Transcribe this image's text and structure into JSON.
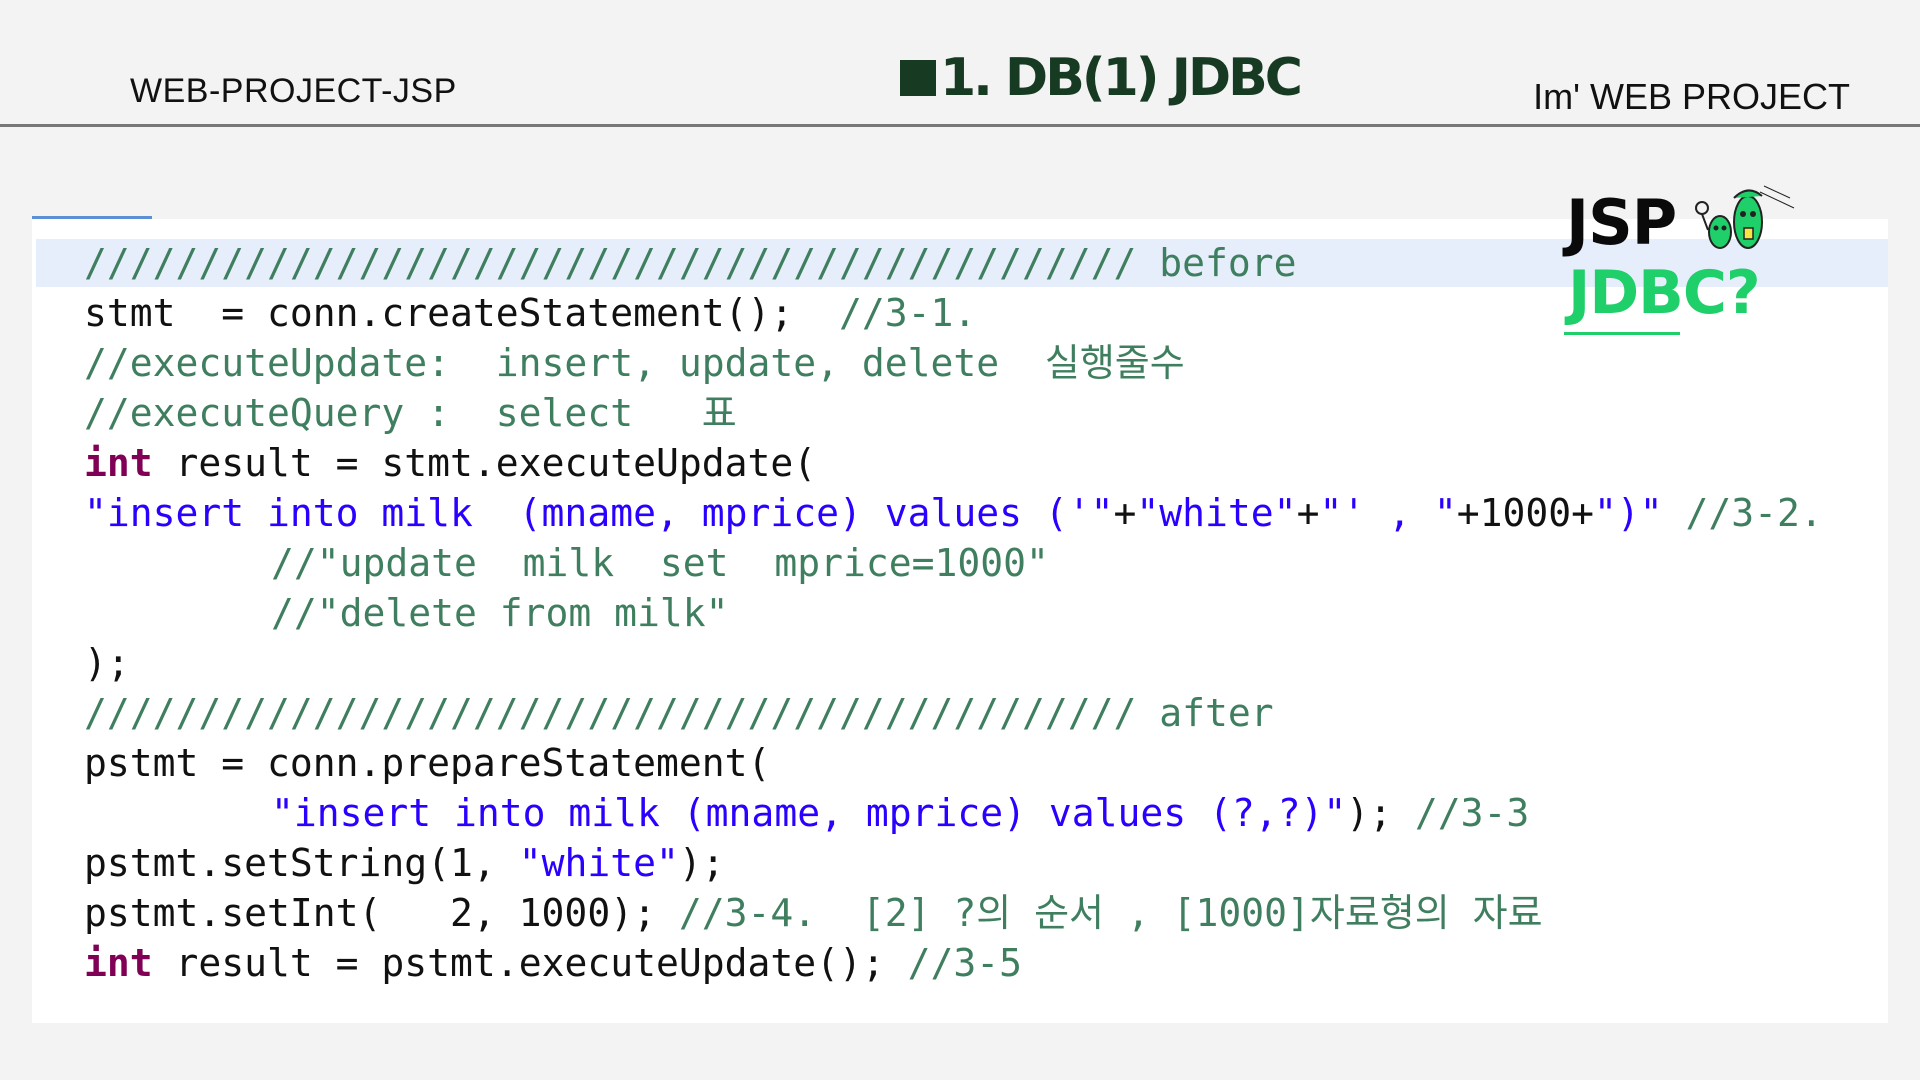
{
  "header": {
    "left": "WEB-PROJECT-JSP",
    "title": "1. DB(1) JDBC",
    "right": "Im'  WEB PROJECT"
  },
  "badge": {
    "line1": "JSP",
    "line2": "JDBC?"
  },
  "code": {
    "l1": {
      "slashes": "////////////////////////////////////////////// before"
    },
    "l2": {
      "code": "stmt  = conn.createStatement();  ",
      "comment": "//3-1."
    },
    "l3": {
      "comment": "//executeUpdate:  insert, update, delete  실행줄수"
    },
    "l4": {
      "comment": "//executeQuery :  select   표"
    },
    "l5": {
      "keyword": "int",
      "code": " result = stmt.executeUpdate("
    },
    "l6": {
      "s1": "\"insert into milk  (mname, mprice) values ('\"",
      "p1": "+",
      "s2": "\"white\"",
      "p2": "+",
      "s3": "\"' , \"",
      "p3": "+1000+",
      "s4": "\")\"",
      "sp": " ",
      "comment": "//3-2."
    },
    "l7": {
      "comment": "//\"update  milk  set  mprice=1000\""
    },
    "l8": {
      "comment": "//\"delete from milk\""
    },
    "l9": {
      "code": ");"
    },
    "l10": {
      "slashes": "////////////////////////////////////////////// after"
    },
    "l11": {
      "code": "pstmt = conn.prepareStatement("
    },
    "l12": {
      "string": "\"insert into milk (mname, mprice) values (?,?)\"",
      "code": "); ",
      "comment": "//3-3"
    },
    "l13": {
      "code1": "pstmt.setString(1, ",
      "string": "\"white\"",
      "code2": ");"
    },
    "l14": {
      "code": "pstmt.setInt(   2, 1000); ",
      "comment": "//3-4.  [2] ?의 순서 , [1000]자료형의 자료"
    },
    "l15": {
      "keyword": "int",
      "code": " result = pstmt.executeUpdate(); ",
      "comment": "//3-5"
    }
  }
}
